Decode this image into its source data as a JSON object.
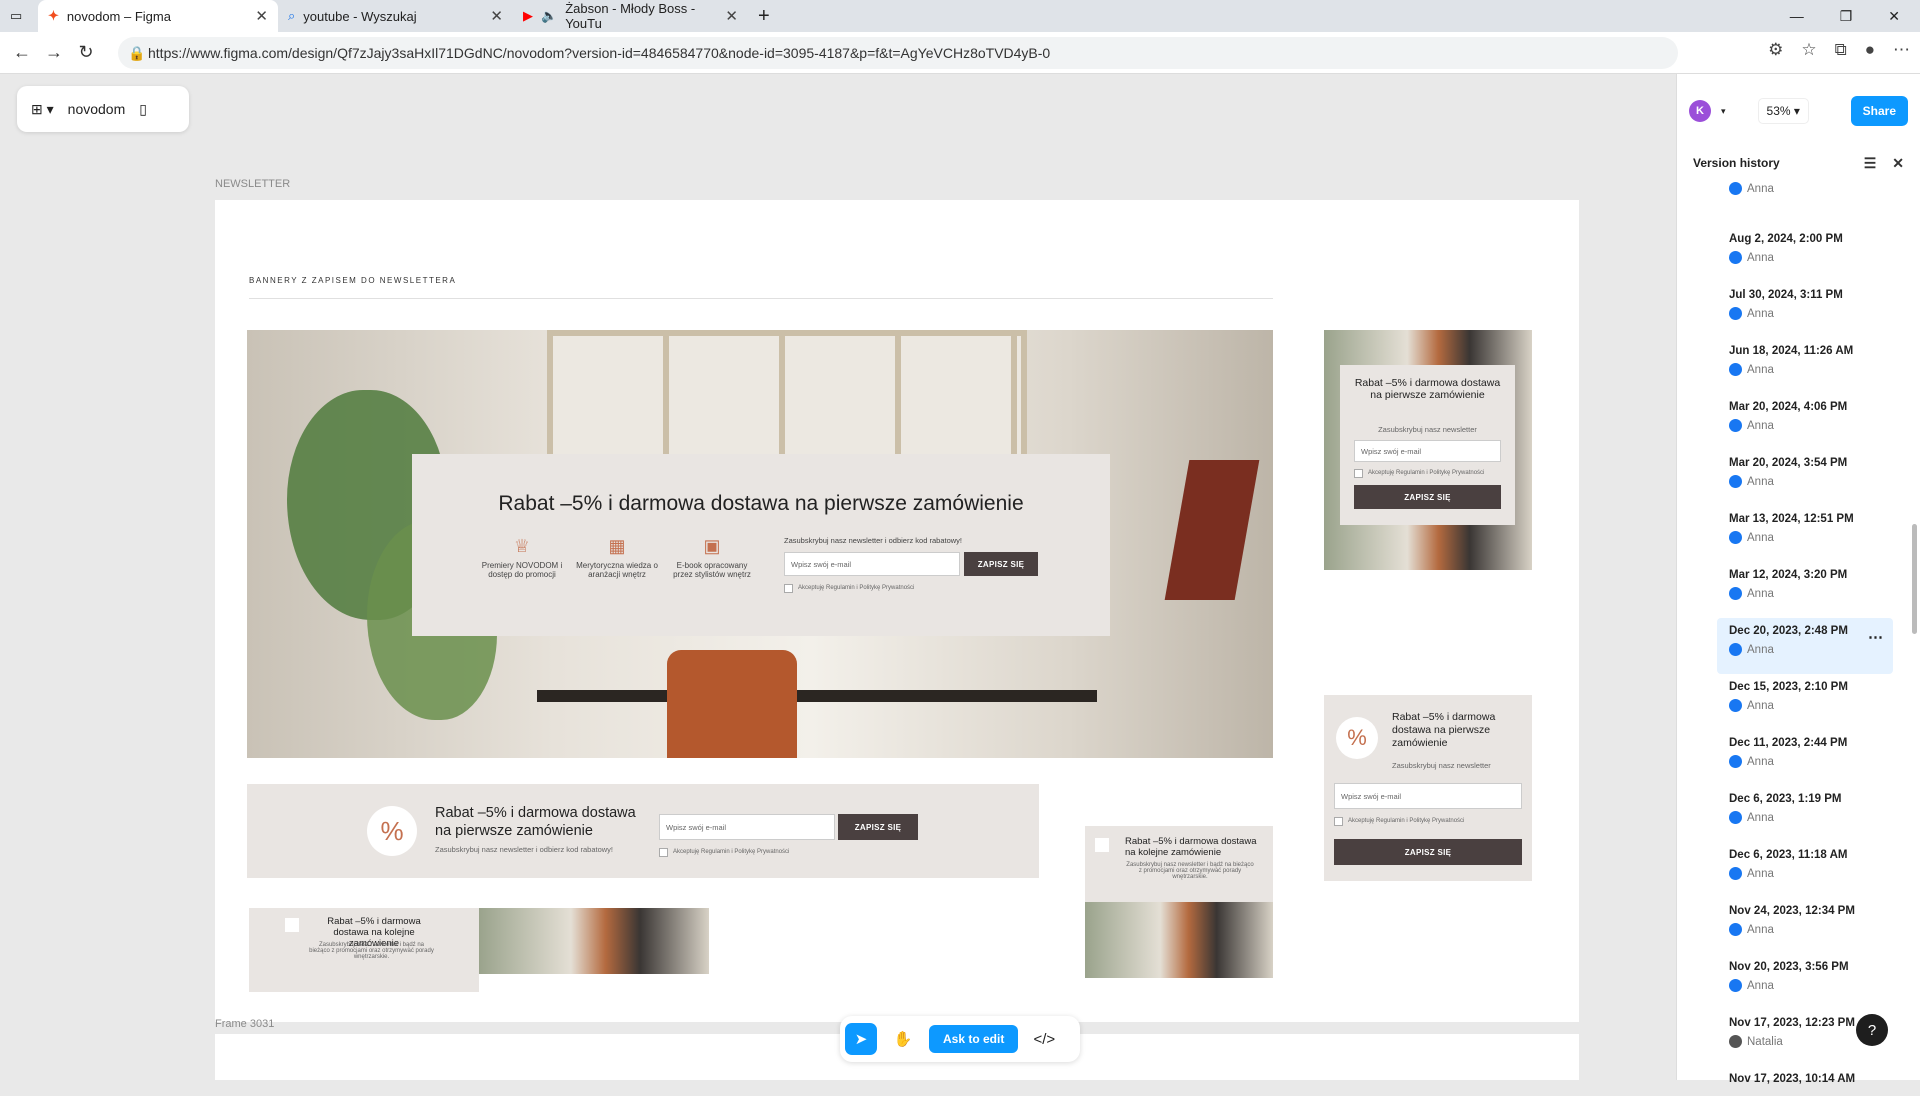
{
  "browser": {
    "tabs": [
      {
        "title": "novodom – Figma",
        "icon": "figma-icon"
      },
      {
        "title": "youtube - Wyszukaj",
        "icon": "search-icon"
      },
      {
        "title": "Żabson - Młody Boss - YouTu",
        "icon": "youtube-icon"
      }
    ],
    "url": "https://www.figma.com/design/Qf7zJajy3saHxIl71DGdNC/novodom?version-id=4846584770&node-id=3095-4187&p=f&t=AgYeVCHz8oTVD4yB-0"
  },
  "figma": {
    "file_name": "novodom",
    "zoom": "53%",
    "share_label": "Share",
    "avatar_initial": "K",
    "ask_to_edit": "Ask to edit"
  },
  "canvas": {
    "section_label": "NEWSLETTER",
    "frame_label": "Frame 3031",
    "heading": "BANNERY Z ZAPISEM DO NEWSLETTERA",
    "hero": {
      "title": "Rabat –5% i darmowa dostawa na pierwsze zamówienie",
      "features": [
        "Premiery NOVODOM i dostęp do promocji",
        "Merytoryczna wiedza o aranżacji wnętrz",
        "E-book opracowany przez stylistów wnętrz"
      ],
      "subscribe_note": "Zasubskrybuj nasz newsletter i odbierz kod rabatowy!",
      "input_placeholder": "Wpisz swój e-mail",
      "button": "ZAPISZ SIĘ",
      "consent": "Akceptuję Regulamin i Politykę Prywatności"
    },
    "small_right": {
      "title": "Rabat –5% i darmowa dostawa na pierwsze zamówienie",
      "note": "Zasubskrybuj nasz newsletter",
      "input_placeholder": "Wpisz swój e-mail",
      "consent": "Akceptuję Regulamin i Politykę Prywatności",
      "button": "ZAPISZ SIĘ"
    },
    "wide_banner": {
      "title": "Rabat –5% i darmowa dostawa na pierwsze zamówienie",
      "note": "Zasubskrybuj nasz newsletter i odbierz kod rabatowy!",
      "input_placeholder": "Wpisz swój e-mail",
      "button": "ZAPISZ SIĘ",
      "consent": "Akceptuję Regulamin i Politykę Prywatności"
    },
    "right_pct_banner": {
      "title": "Rabat –5% i darmowa dostawa na pierwsze zamówienie",
      "note": "Zasubskrybuj nasz newsletter",
      "input_placeholder": "Wpisz swój e-mail",
      "consent": "Akceptuję Regulamin i Politykę Prywatności",
      "button": "ZAPISZ SIĘ"
    },
    "mini_card": {
      "title": "Rabat –5% i darmowa dostawa na kolejne zamówienie",
      "note": "Zasubskrybuj nasz newsletter i bądź na bieżąco z promocjami oraz otrzymywać porady wnętrzarskie."
    },
    "strip_banner": {
      "title": "Rabat –5% i darmowa dostawa na kolejne zamówienie",
      "note": "Zasubskrybuj nasz newsletter i bądź na bieżąco z promocjami oraz otrzymywać porady wnętrzarskie."
    }
  },
  "version_history": {
    "title": "Version history",
    "entries": [
      {
        "date": "",
        "author": "Anna"
      },
      {
        "date": "Aug 2, 2024, 2:00 PM",
        "author": "Anna"
      },
      {
        "date": "Jul 30, 2024, 3:11 PM",
        "author": "Anna"
      },
      {
        "date": "Jun 18, 2024, 11:26 AM",
        "author": "Anna"
      },
      {
        "date": "Mar 20, 2024, 4:06 PM",
        "author": "Anna"
      },
      {
        "date": "Mar 20, 2024, 3:54 PM",
        "author": "Anna"
      },
      {
        "date": "Mar 13, 2024, 12:51 PM",
        "author": "Anna"
      },
      {
        "date": "Mar 12, 2024, 3:20 PM",
        "author": "Anna"
      },
      {
        "date": "Dec 20, 2023, 2:48 PM",
        "author": "Anna",
        "selected": true
      },
      {
        "date": "Dec 15, 2023, 2:10 PM",
        "author": "Anna"
      },
      {
        "date": "Dec 11, 2023, 2:44 PM",
        "author": "Anna"
      },
      {
        "date": "Dec 6, 2023, 1:19 PM",
        "author": "Anna"
      },
      {
        "date": "Dec 6, 2023, 11:18 AM",
        "author": "Anna"
      },
      {
        "date": "Nov 24, 2023, 12:34 PM",
        "author": "Anna"
      },
      {
        "date": "Nov 20, 2023, 3:56 PM",
        "author": "Anna"
      },
      {
        "date": "Nov 17, 2023, 12:23 PM",
        "author": "Natalia"
      },
      {
        "date": "Nov 17, 2023, 10:14 AM",
        "author": ""
      }
    ]
  },
  "colors": {
    "accent": "#0d99ff",
    "button_dark": "#4a4040",
    "banner_bg": "#e9e5e2",
    "terracotta": "#c4704f"
  }
}
